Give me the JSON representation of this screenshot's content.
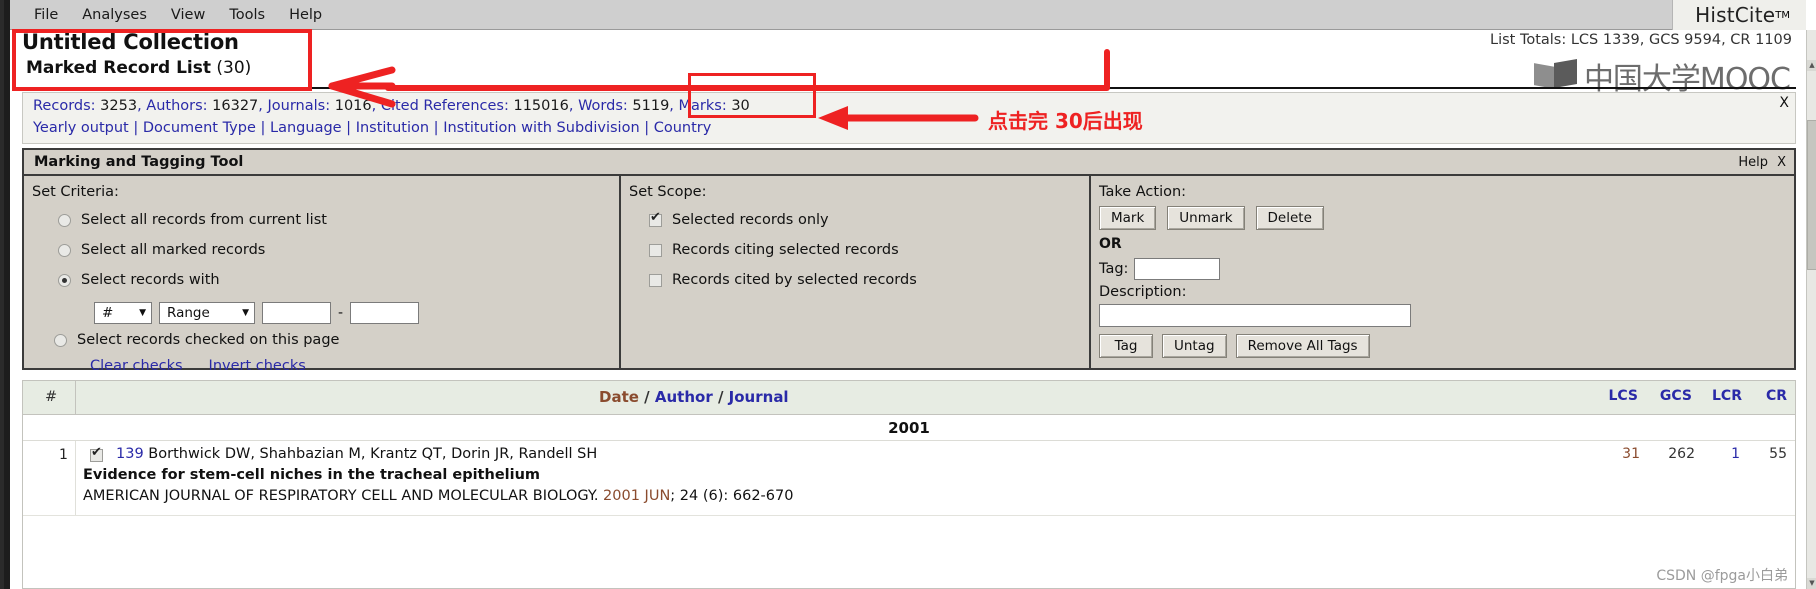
{
  "menubar": {
    "items": [
      "File",
      "Analyses",
      "View",
      "Tools",
      "Help"
    ]
  },
  "brand": {
    "name": "HistCite",
    "tm": "TM"
  },
  "header": {
    "collection_title": "Untitled Collection",
    "marked_list_label": "Marked Record List",
    "marked_list_count": "(30)",
    "list_totals": "List Totals: LCS 1339, GCS 9594, CR 1109",
    "watermark_text": "中国大学MOOC"
  },
  "stats": {
    "records_label": "Records:",
    "records_value": "3253",
    "authors_label": "Authors:",
    "authors_value": "16327",
    "journals_label": "Journals:",
    "journals_value": "1016",
    "cited_refs_label": "Cited References:",
    "cited_refs_value": "115016",
    "words_label": "Words:",
    "words_value": "5119",
    "marks_label": "Marks:",
    "marks_value": "30",
    "links": [
      "Yearly output",
      "Document Type",
      "Language",
      "Institution",
      "Institution with Subdivision",
      "Country"
    ],
    "close_label": "X"
  },
  "tool": {
    "title": "Marking and Tagging Tool",
    "help_label": "Help",
    "close_label": "X",
    "criteria": {
      "label": "Set Criteria:",
      "options": [
        {
          "text": "Select all records from current list",
          "selected": false
        },
        {
          "text": "Select all marked records",
          "selected": false
        },
        {
          "text": "Select records with",
          "selected": true
        },
        {
          "text": "Select records checked on this page",
          "selected": false
        }
      ],
      "field_select_value": "#",
      "mode_select_value": "Range",
      "from_value": "",
      "to_value": "",
      "dash": "-",
      "clear_checks": "Clear checks",
      "invert_checks": "Invert checks"
    },
    "scope": {
      "label": "Set Scope:",
      "options": [
        {
          "text": "Selected records only",
          "checked": true
        },
        {
          "text": "Records citing selected records",
          "checked": false
        },
        {
          "text": "Records cited by selected records",
          "checked": false
        }
      ]
    },
    "action": {
      "label": "Take Action:",
      "mark": "Mark",
      "unmark": "Unmark",
      "delete": "Delete",
      "or": "OR",
      "tag_label": "Tag:",
      "tag_value": "",
      "description_label": "Description:",
      "description_value": "",
      "tag_button": "Tag",
      "untag_button": "Untag",
      "remove_all_tags": "Remove All Tags"
    }
  },
  "results": {
    "col_hash": "#",
    "col_date": "Date",
    "col_author": "Author",
    "col_journal": "Journal",
    "slash": "/",
    "col_lcs": "LCS",
    "col_gcs": "GCS",
    "col_lcr": "LCR",
    "col_cr": "CR",
    "year_group": "2001",
    "rows": [
      {
        "index": "1",
        "checked": true,
        "record_id": "139",
        "authors": "Borthwick DW, Shahbazian M, Krantz QT, Dorin JR, Randell SH",
        "title": "Evidence for stem-cell niches in the tracheal epithelium",
        "journal": "AMERICAN JOURNAL OF RESPIRATORY CELL AND MOLECULAR BIOLOGY.",
        "pub_date": "2001 JUN",
        "citation_tail": "; 24 (6): 662-670",
        "lcs": "31",
        "gcs": "262",
        "lcr": "1",
        "cr": "55"
      }
    ]
  },
  "annotations": {
    "note_text": "点击完 30后出现",
    "accent_color": "#ee2222"
  },
  "watermark": {
    "credit": "CSDN @fpga小白弟"
  }
}
